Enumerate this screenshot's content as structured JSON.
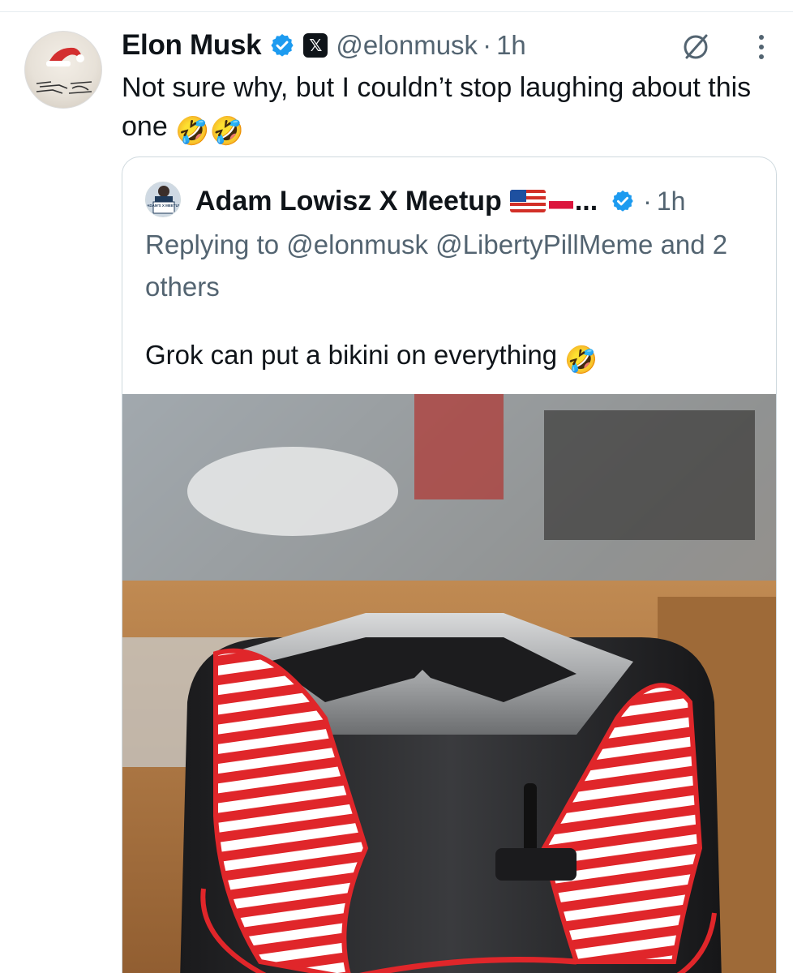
{
  "tweet": {
    "author_name": "Elon Musk",
    "handle": "@elonmusk",
    "separator": "·",
    "time": "1h",
    "text": "Not sure why, but I couldn’t stop laughing about this one",
    "emoji": "🤣🤣",
    "x_badge": "𝕏"
  },
  "icons": {
    "verified": "verified-badge-icon",
    "grok": "grok-icon",
    "more": "more-vertical-icon"
  },
  "quote": {
    "author_name": "Adam Lowisz X Meetup",
    "name_ellipsis": "...",
    "separator": "·",
    "time": "1h",
    "replying_prefix": "Replying to ",
    "replying_to": "@elonmusk @LibertyPillMeme",
    "replying_suffix": " and 2 others",
    "text": "Grok can put a bikini on everything",
    "emoji": "🤣",
    "avatar_text": "ADAM'S X MEETUP"
  },
  "colors": {
    "verified_blue": "#1d9bf0",
    "secondary_text": "#536471",
    "primary_text": "#0f1419",
    "border": "#cfd9de"
  }
}
